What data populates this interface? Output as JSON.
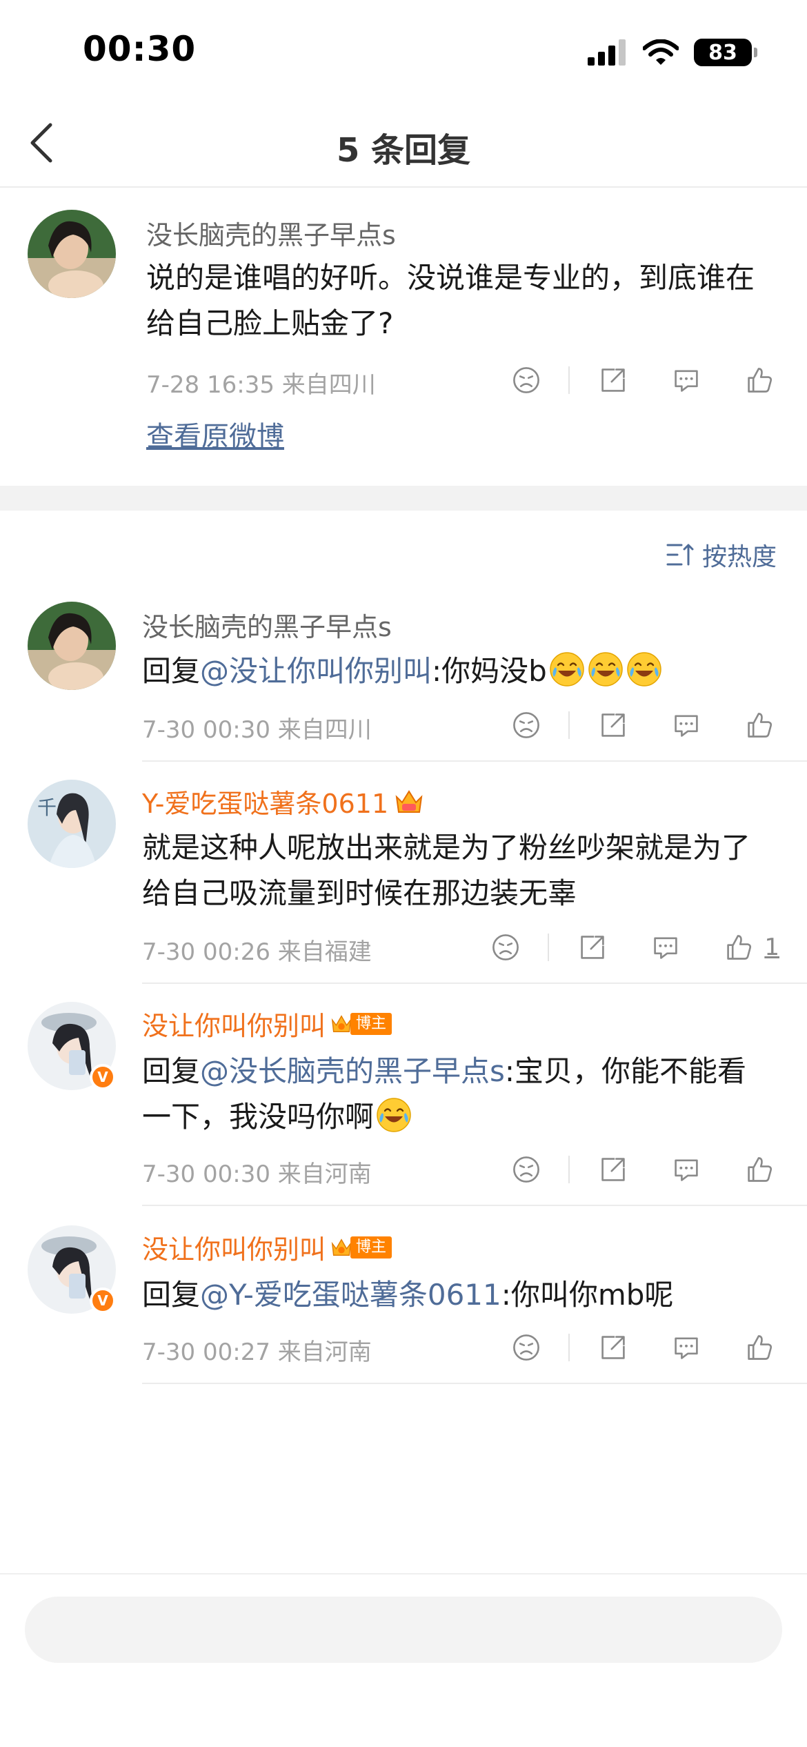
{
  "status_bar": {
    "time": "00:30",
    "battery": "83"
  },
  "nav": {
    "title": "5 条回复"
  },
  "original_comment": {
    "username": "没长脑壳的黑子早点s",
    "content": "说的是谁唱的好听。没说谁是专业的，到底谁在给自己脸上贴金了?",
    "meta": "7-28 16:35  来自四川",
    "view_original": "查看原微博"
  },
  "sort": {
    "label": "按热度"
  },
  "replies": [
    {
      "username": "没长脑壳的黑子早点s",
      "prefix": "回复",
      "mention": "@没让你叫你别叫",
      "text": ":你妈没b",
      "meta": "7-30 00:30  来自四川",
      "likes": ""
    },
    {
      "username": "Y-爱吃蛋哒薯条0611",
      "text": "就是这种人呢放出来就是为了粉丝吵架就是为了给自己吸流量到时候在那边装无辜",
      "meta": "7-30 00:26  来自福建",
      "likes": "1"
    },
    {
      "username": "没让你叫你别叫",
      "badge": "博主",
      "prefix": "回复",
      "mention": "@没长脑壳的黑子早点s",
      "text": ":宝贝，你能不能看一下，我没吗你啊",
      "meta": "7-30 00:30  来自河南",
      "likes": ""
    },
    {
      "username": "没让你叫你别叫",
      "badge": "博主",
      "prefix": "回复",
      "mention": "@Y-爱吃蛋哒薯条0611",
      "text": ":你叫你mb呢",
      "meta": "7-30 00:27  来自河南",
      "likes": ""
    }
  ],
  "colors": {
    "link": "#4f6c98",
    "orange_name": "#f0711c",
    "meta": "#a3a3a3"
  }
}
